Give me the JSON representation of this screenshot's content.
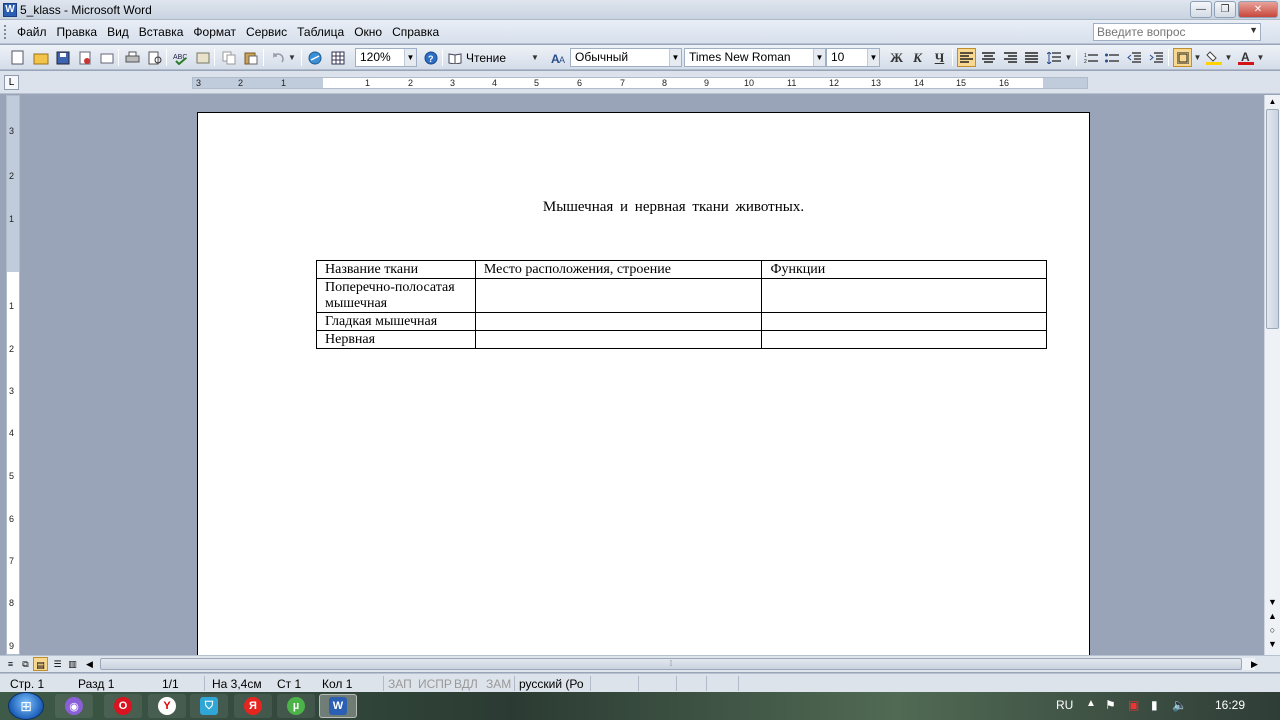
{
  "window": {
    "title": "5_klass - Microsoft Word",
    "app_icon": "W"
  },
  "window_buttons": {
    "minimize": "—",
    "restore": "❐",
    "close": "✕"
  },
  "menu": {
    "items": [
      "Файл",
      "Правка",
      "Вид",
      "Вставка",
      "Формат",
      "Сервис",
      "Таблица",
      "Окно",
      "Справка"
    ],
    "ask_placeholder": "Введите вопрос"
  },
  "toolbar": {
    "zoom": "120%",
    "reading_label": "Чтение",
    "style": "Обычный",
    "font": "Times New Roman",
    "font_size": "10",
    "bold": "Ж",
    "italic": "К",
    "underline": "Ч",
    "highlight_color": "#ffd200",
    "font_color": "#d41414"
  },
  "ruler": {
    "corner": "L",
    "h_ticks": [
      "3",
      "2",
      "1",
      "1",
      "2",
      "3",
      "4",
      "5",
      "6",
      "7",
      "8",
      "9",
      "10",
      "11",
      "12",
      "13",
      "14",
      "15",
      "16"
    ],
    "v_ticks": [
      "3",
      "2",
      "1",
      "1",
      "2",
      "3",
      "4",
      "5",
      "6",
      "7",
      "8",
      "9"
    ]
  },
  "document": {
    "title": "Мышечная   и  нервная  ткани животных.",
    "table": {
      "headers": [
        "Название ткани",
        "Место расположения, строение",
        "Функции"
      ],
      "rows": [
        [
          "Поперечно-полосатая мышечная",
          "",
          ""
        ],
        [
          "Гладкая мышечная",
          "",
          ""
        ],
        [
          "Нервная",
          "",
          ""
        ]
      ]
    }
  },
  "status": {
    "page": "Стр. 1",
    "section": "Разд 1",
    "pages": "1/1",
    "at": "На 3,4см",
    "line": "Ст 1",
    "col": "Кол 1",
    "rec": "ЗАП",
    "trk": "ИСПР",
    "ext": "ВДЛ",
    "ovr": "ЗАМ",
    "lang": "русский (Ро"
  },
  "taskbar": {
    "lang": "RU",
    "time": "16:29"
  }
}
